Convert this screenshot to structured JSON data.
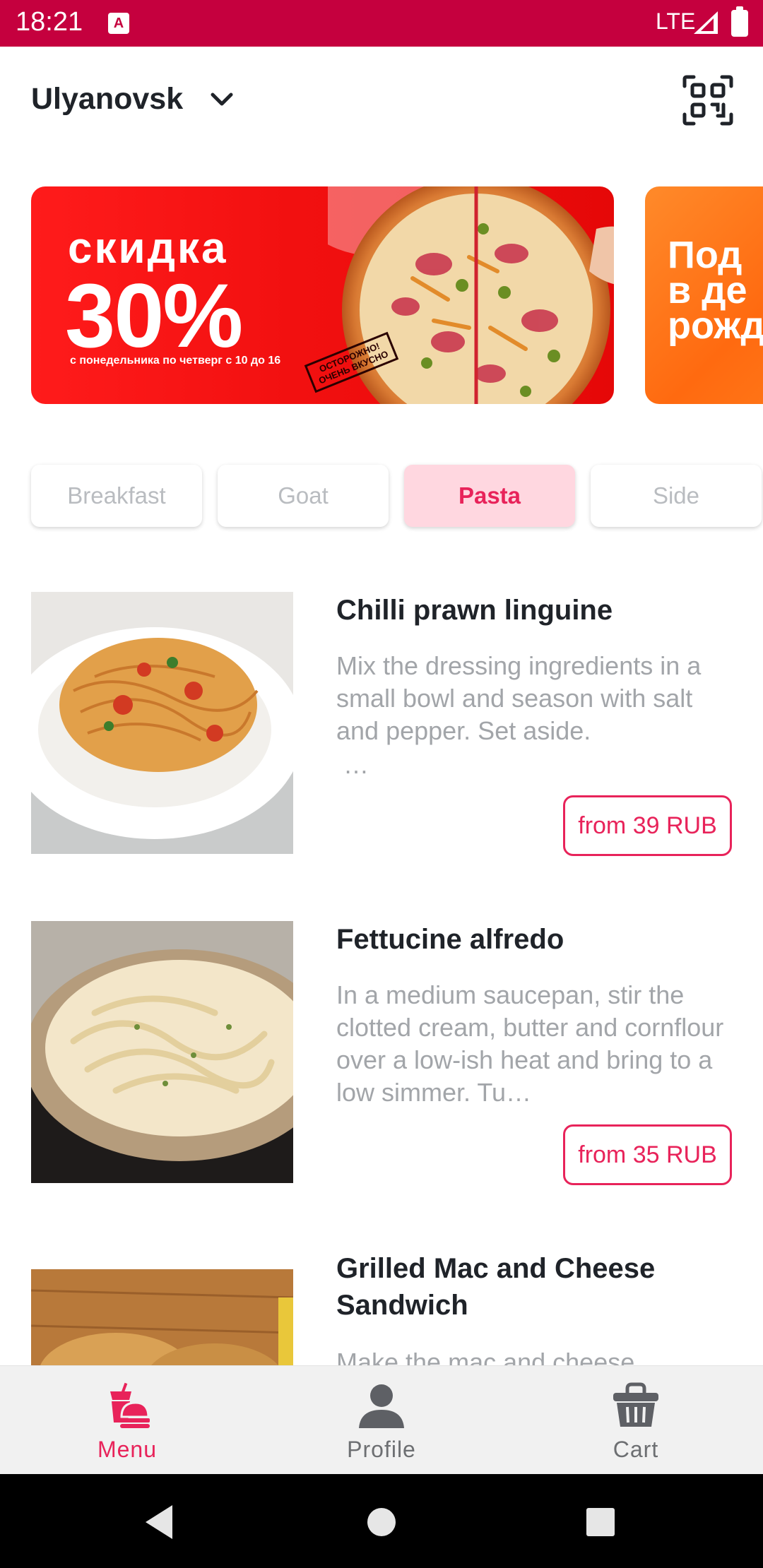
{
  "status_bar": {
    "time": "18:21",
    "notification_icon": "A",
    "network": "LTE",
    "icons": [
      "signal-icon",
      "battery-icon"
    ]
  },
  "header": {
    "city": "Ulyanovsk",
    "icons": [
      "chevron-down-icon",
      "qr-code-icon"
    ]
  },
  "banners": [
    {
      "title": "скидка",
      "percent": "30%",
      "subtitle": "с понедельника по четверг с 10 до 16",
      "stamp_line1": "ОСТОРОЖНО!",
      "stamp_line2": "ОЧЕНЬ ВКУСНО",
      "color": "#f21010"
    },
    {
      "text": "Под\nв де\nрожд",
      "color": "#ff6a10"
    }
  ],
  "categories": [
    {
      "label": "Breakfast",
      "active": false
    },
    {
      "label": "Goat",
      "active": false
    },
    {
      "label": "Pasta",
      "active": true
    },
    {
      "label": "Side",
      "active": false
    }
  ],
  "products": [
    {
      "title": "Chilli prawn linguine",
      "description": "Mix the dressing ingredients in a small bowl and season with salt and pepper. Set aside.",
      "description_ellipsis": "…",
      "price": "from 39 RUB"
    },
    {
      "title": "Fettucine alfredo",
      "description": "In a medium saucepan, stir the clotted cream, butter and cornflour over a low-ish heat and bring to a low simmer. Tu…",
      "price": "from 35 RUB"
    },
    {
      "title": "Grilled Mac and Cheese Sandwich",
      "description": "Make the mac and cheese"
    }
  ],
  "bottom_nav": [
    {
      "label": "Menu",
      "icon": "food-icon",
      "active": true
    },
    {
      "label": "Profile",
      "icon": "user-icon",
      "active": false
    },
    {
      "label": "Cart",
      "icon": "basket-icon",
      "active": false
    }
  ],
  "system_nav": [
    "back-icon",
    "home-icon",
    "recents-icon"
  ],
  "colors": {
    "accent": "#e8235a",
    "status_bar": "#c5003e",
    "active_chip_bg": "#ffd7e0"
  }
}
